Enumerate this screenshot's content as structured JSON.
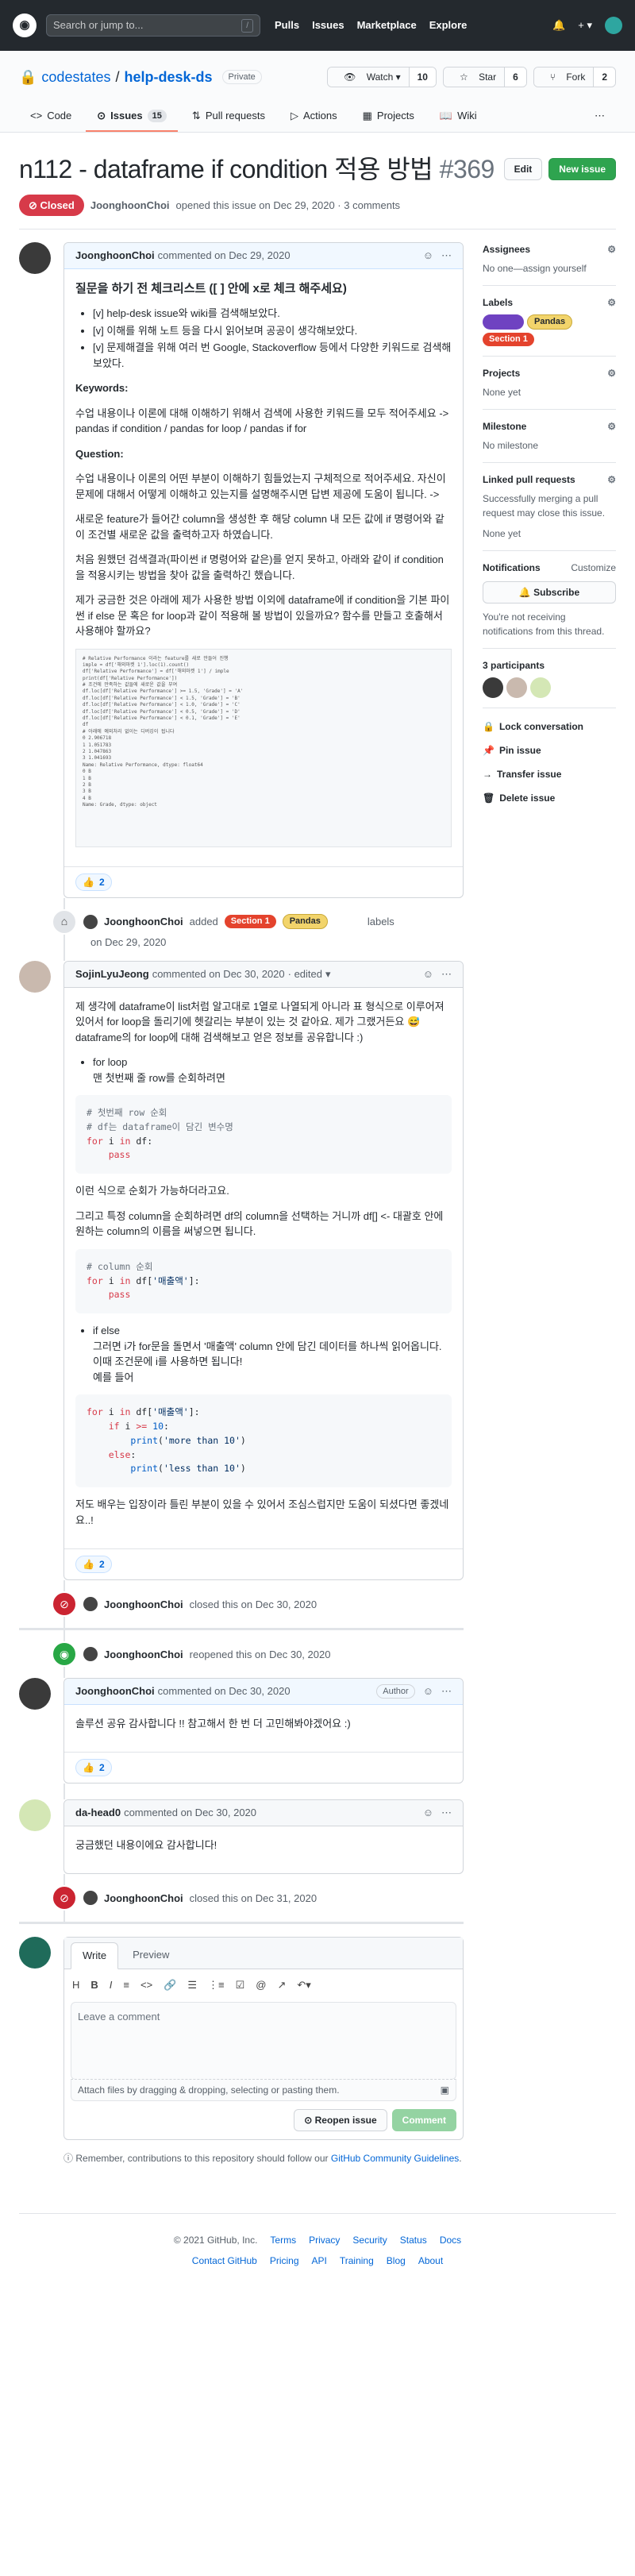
{
  "header": {
    "search_placeholder": "Search or jump to...",
    "slash": "/",
    "nav": [
      "Pulls",
      "Issues",
      "Marketplace",
      "Explore"
    ]
  },
  "repo": {
    "owner": "codestates",
    "sep": "/",
    "name": "help-desk-ds",
    "visibility": "Private",
    "watch": "Watch",
    "watch_count": "10",
    "star": "Star",
    "star_count": "6",
    "fork": "Fork",
    "fork_count": "2"
  },
  "tabs": [
    {
      "label": "Code"
    },
    {
      "label": "Issues",
      "count": "15"
    },
    {
      "label": "Pull requests"
    },
    {
      "label": "Actions"
    },
    {
      "label": "Projects"
    },
    {
      "label": "Wiki"
    }
  ],
  "issue": {
    "title": "n112 - dataframe if condition 적용 방법",
    "number": "#369",
    "edit": "Edit",
    "new_issue": "New issue",
    "state": "Closed",
    "meta_author": "JoonghoonChoi",
    "meta_text": "opened this issue on Dec 29, 2020 · 3 comments"
  },
  "c1": {
    "author": "JoonghoonChoi",
    "date": "commented on Dec 29, 2020",
    "heading": "질문을 하기 전 체크리스트 ([ ] 안에 x로 체크 해주세요)",
    "checklist": [
      "[v] help-desk issue와 wiki를 검색해보았다.",
      "[v] 이해를 위해 노트 등을 다시 읽어보며 공공이 생각해보았다.",
      "[v] 문제해결을 위해 여러 번 Google, Stackoverflow 등에서 다양한 키워드로 검색해보았다."
    ],
    "kw_label": "Keywords:",
    "kw_text": "수업 내용이나 이론에 대해 이해하기 위해서 검색에 사용한 키워드를 모두 적어주세요 -> pandas if condition / pandas for loop / pandas if for",
    "q_label": "Question:",
    "q1": "수업 내용이나 이론의 어떤 부분이 이해하기 힘들었는지 구체적으로 적어주세요. 자신이 문제에 대해서 어떻게 이해하고 있는지를 설명해주시면 답변 제공에 도움이 됩니다. ->",
    "q2": "새로운 feature가 들어간 column을 생성한 후 해당 column 내 모든 값에 if 명령어와 같이 조건별 새로운 값을 출력하고자 하였습니다.",
    "q3": "처음 원했던 검색결과(파이썬 if 명령어와 같은)를 얻지 못하고, 아래와 같이 if condition을 적용시키는 방법을 찾아 값을 출력하긴 했습니다.",
    "q4": "제가 궁금한 것은 아래에 제가 사용한 방법 이외에 dataframe에 if condition을 기본 파이썬 if else 문 혹은 for loop과 같이 적용해 볼 방법이 있을까요? 함수를 만들고 호출해서 사용해야 할까요?",
    "shot_lines": [
      "# Relative Performance 이라는 feature를 새로 만들어 진행",
      "imple = df['해외마켓 1'].loc(1).count()",
      "df['Relative Performance'] = df['해외마켓 1'] / imple",
      "print(df['Relative Performance'])",
      "# 조건에 만족하는 값들에 새로운 값을 부여",
      "df.loc[df['Relative Performance'] >= 1.5, 'Grade'] = 'A'",
      "df.loc[df['Relative Performance'] < 1.5, 'Grade'] = 'B'",
      "df.loc[df['Relative Performance'] < 1.0, 'Grade'] = 'C'",
      "df.loc[df['Relative Performance'] < 0.5, 'Grade'] = 'D'",
      "df.loc[df['Relative Performance'] < 0.1, 'Grade'] = 'E'",
      "df",
      "# 아래에 예외처리 없이는 디버깅이 됩니다",
      "0    2.906718",
      "1    1.051783",
      "2    1.047863",
      "3    1.041693",
      "Name: Relative Performance, dtype: float64",
      "0    B",
      "1    B",
      "2    B",
      "3    B",
      "4    B",
      "Name: Grade, dtype: object"
    ],
    "reaction": "👍",
    "reaction_count": "2"
  },
  "labels_event": {
    "author": "JoonghoonChoi",
    "added": "added",
    "labels": [
      {
        "name": "Section 1",
        "bg": "#e4432d",
        "fg": "#ffffff"
      },
      {
        "name": "Pandas",
        "bg": "#f2d46b",
        "fg": "#24292e"
      },
      {
        "name": "",
        "bg": "#6f42c1",
        "fg": "#ffffff"
      }
    ],
    "suffix": "labels",
    "date": "on Dec 29, 2020"
  },
  "c2": {
    "author": "SojinLyuJeong",
    "date": "commented on Dec 30, 2020",
    "edited": "· edited",
    "p1": "제 생각에 dataframe이 list처럼 알고대로 1열로 나열되게 아니라 표 형식으로 이루어져 있어서 for loop을 돌리기에 헷갈리는 부분이 있는 것 같아요. 제가 그랬거든요 😅 dataframe의 for loop에 대해 검색해보고 얻은 정보를 공유합니다 :)",
    "li1": "for loop",
    "li1b": "맨 첫번째 줄 row를 순회하려면",
    "p2": "이런 식으로 순회가 가능하더라고요.",
    "p3": "그리고 특정 column을 순회하려면 df의 column을 선택하는 거니까 df[] <- 대괄호 안에 원하는 column의 이름을 써넣으면 됩니다.",
    "li2": "if else",
    "li2b": "그러면 i가 for문을 돌면서 '매출액' column 안에 담긴 데이터를 하나씩 읽어옵니다.",
    "li2c": "이때 조건문에 i를 사용하면 됩니다!",
    "li2d": "예를 들어",
    "p4": "저도 배우는 입장이라 틀린 부분이 있을 수 있어서 조심스럽지만 도움이 되셨다면 좋겠네요..!",
    "reaction": "👍",
    "reaction_count": "2"
  },
  "ev_closed1": {
    "author": "JoonghoonChoi",
    "text": "closed this on Dec 30, 2020"
  },
  "ev_reopen": {
    "author": "JoonghoonChoi",
    "text": "reopened this on Dec 30, 2020"
  },
  "c3": {
    "author": "JoonghoonChoi",
    "date": "commented on Dec 30, 2020",
    "badge": "Author",
    "body": "솔루션 공유 감사합니다 !! 참고해서 한 번 더 고민해봐야겠어요 :)",
    "reaction": "👍",
    "reaction_count": "2"
  },
  "c4": {
    "author": "da-head0",
    "date": "commented on Dec 30, 2020",
    "body": "궁금했던 내용이에요 감사합니다!"
  },
  "ev_closed2": {
    "author": "JoonghoonChoi",
    "text": "closed this on Dec 31, 2020"
  },
  "editor": {
    "write": "Write",
    "preview": "Preview",
    "placeholder": "Leave a comment",
    "attach": "Attach files by dragging & dropping, selecting or pasting them.",
    "reopen": "Reopen issue",
    "comment": "Comment",
    "note": "Remember, contributions to this repository should follow our",
    "note_link": "GitHub Community Guidelines",
    "note_end": "."
  },
  "sidebar": {
    "assignees": "Assignees",
    "assignees_val": "No one—assign yourself",
    "labels": "Labels",
    "projects": "Projects",
    "projects_val": "None yet",
    "milestone": "Milestone",
    "milestone_val": "No milestone",
    "linked": "Linked pull requests",
    "linked_desc": "Successfully merging a pull request may close this issue.",
    "linked_val": "None yet",
    "notif": "Notifications",
    "customize": "Customize",
    "subscribe": "🔔 Subscribe",
    "notif_desc": "You're not receiving notifications from this thread.",
    "participants": "3 participants",
    "lock": "Lock conversation",
    "pin": "Pin issue",
    "transfer": "Transfer issue",
    "delete": "Delete issue"
  },
  "footer": {
    "copy": "© 2021 GitHub, Inc.",
    "row1": [
      "Terms",
      "Privacy",
      "Security",
      "Status",
      "Docs"
    ],
    "row2": [
      "Contact GitHub",
      "Pricing",
      "API",
      "Training",
      "Blog",
      "About"
    ]
  }
}
